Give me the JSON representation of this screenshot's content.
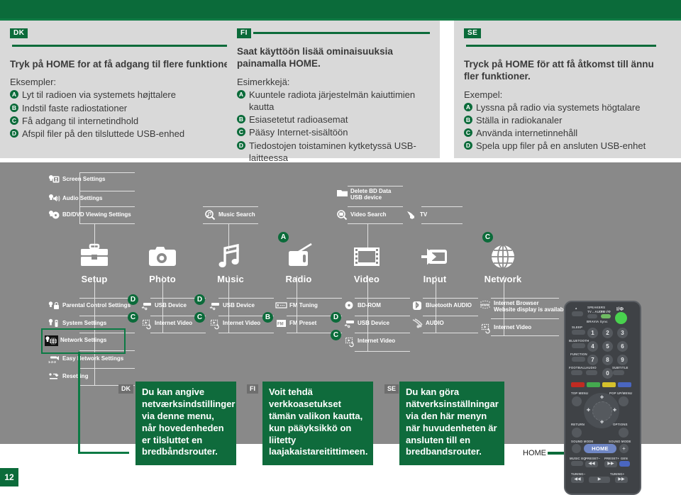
{
  "page": {
    "number": "12"
  },
  "panels": [
    {
      "tag": "DK",
      "headline": "Tryk på HOME for at få adgang til flere funktioner.",
      "sub": "Eksempler:",
      "items": [
        {
          "badge": "A",
          "text": "Lyt til radioen via systemets højttalere"
        },
        {
          "badge": "B",
          "text": "Indstil faste radiostationer"
        },
        {
          "badge": "C",
          "text": "Få adgang til internetindhold"
        },
        {
          "badge": "D",
          "text": "Afspil filer på den tilsluttede USB-enhed"
        }
      ]
    },
    {
      "tag": "FI",
      "headline": "Saat käyttöön lisää ominaisuuksia painamalla HOME.",
      "sub": "Esimerkkejä:",
      "items": [
        {
          "badge": "A",
          "text": "Kuuntele radiota järjestelmän kaiuttimien kautta"
        },
        {
          "badge": "B",
          "text": "Esiasetetut radioasemat"
        },
        {
          "badge": "C",
          "text": "Pääsy Internet-sisältöön"
        },
        {
          "badge": "D",
          "text": "Tiedostojen toistaminen kytketyssä USB-laitteessa"
        }
      ]
    },
    {
      "tag": "SE",
      "headline": "Tryck på HOME för att få åtkomst till ännu fler funktioner.",
      "sub": "Exempel:",
      "items": [
        {
          "badge": "A",
          "text": "Lyssna på radio via systemets högtalare"
        },
        {
          "badge": "B",
          "text": "Ställa in radiokanaler"
        },
        {
          "badge": "C",
          "text": "Använda internetinnehåll"
        },
        {
          "badge": "D",
          "text": "Spela upp filer på en ansluten USB-enhet"
        }
      ]
    }
  ],
  "menu_map": {
    "main_icons": [
      {
        "label": "Setup",
        "icon": "toolbox-icon",
        "badge": ""
      },
      {
        "label": "Photo",
        "icon": "camera-icon",
        "badge": ""
      },
      {
        "label": "Music",
        "icon": "music-note-icon",
        "badge": ""
      },
      {
        "label": "Radio",
        "icon": "radio-icon",
        "badge": "A"
      },
      {
        "label": "Video",
        "icon": "film-strip-icon",
        "badge": ""
      },
      {
        "label": "Input",
        "icon": "input-arrow-icon",
        "badge": ""
      },
      {
        "label": "Network",
        "icon": "globe-icon",
        "badge": "C"
      }
    ],
    "setup_upper": [
      {
        "label": "Screen Settings",
        "icon": "screen-settings-icon"
      },
      {
        "label": "Audio Settings",
        "icon": "audio-settings-icon"
      },
      {
        "label": "BD/DVD Viewing Settings",
        "icon": "bd-dvd-settings-icon"
      }
    ],
    "setup_lower": [
      {
        "label": "Parental Control Settings",
        "icon": "parental-lock-icon",
        "badge": ""
      },
      {
        "label": "System Settings",
        "icon": "system-settings-icon",
        "badge": ""
      },
      {
        "label": "Network Settings",
        "icon": "network-settings-icon",
        "badge": "",
        "highlighted": true
      },
      {
        "label": "Easy Network Settings",
        "icon": "easy-network-icon",
        "badge": ""
      },
      {
        "label": "Resetting",
        "icon": "resetting-icon",
        "badge": ""
      }
    ],
    "music_children": [
      {
        "label": "Music Search",
        "icon": "music-search-icon"
      }
    ],
    "photo_children": [
      {
        "label": "USB Device",
        "icon": "usb-device-icon",
        "badge": "D"
      },
      {
        "label": "Internet Video",
        "icon": "internet-video-icon",
        "badge": "C"
      }
    ],
    "music_sources": [
      {
        "label": "USB Device",
        "icon": "usb-device-icon",
        "badge": "D"
      },
      {
        "label": "Internet Video",
        "icon": "internet-video-icon",
        "badge": "C"
      }
    ],
    "radio_children": [
      {
        "label": "FM Tuning",
        "icon": "fm-tuning-icon",
        "badge": ""
      },
      {
        "label": "FM Preset",
        "icon": "fm-preset-icon",
        "badge": "B"
      }
    ],
    "video_top": [
      {
        "label": "Delete BD Data\nUSB device",
        "icon": "folder-icon"
      },
      {
        "label": "Video Search",
        "icon": "video-search-icon"
      },
      {
        "label": "TV",
        "icon": "tv-icon"
      }
    ],
    "video_children": [
      {
        "label": "BD-ROM",
        "icon": "disc-icon",
        "badge": ""
      },
      {
        "label": "USB Device",
        "icon": "usb-device-icon",
        "badge": "D"
      },
      {
        "label": "Internet Video",
        "icon": "internet-video-icon",
        "badge": "C"
      }
    ],
    "input_children": [
      {
        "label": "Bluetooth AUDIO",
        "icon": "bluetooth-icon"
      },
      {
        "label": "AUDIO",
        "icon": "audio-cable-icon"
      }
    ],
    "network_children": [
      {
        "label": "Internet Browser\nWebsite display is available",
        "icon": "www-icon"
      },
      {
        "label": "Internet Video",
        "icon": "internet-video-icon"
      }
    ]
  },
  "callouts": [
    {
      "tag": "DK",
      "text": "Du kan angive netværksindstillinger via denne menu, når hovedenheden er tilsluttet en bredbåndsrouter."
    },
    {
      "tag": "FI",
      "text": "Voit tehdä verkkoasetukset tämän valikon kautta, kun pääyksikkö on liitetty laajakaistareitittimeen."
    },
    {
      "tag": "SE",
      "text": "Du kan göra nätverksinställningar via den här menyn när huvudenheten är ansluten till en bredbandsrouter."
    }
  ],
  "remote": {
    "home_callout_label": "HOME",
    "home_button": "HOME",
    "labels": {
      "speakers": "SPEAKERS",
      "tv_audio": "TV↔AUDIO",
      "tv_power": "TV I/Φ",
      "bravia": "BRAVIA Sync",
      "power": "I/Φ",
      "sleep": "SLEEP",
      "bluetooth": "BLUETOOTH",
      "function": "FUNCTION",
      "football": "FOOTBALL",
      "audio": "AUDIO",
      "subtitle": "SUBTITLE",
      "top_menu": "TOP MENU",
      "popup_menu": "POP UP/MENU",
      "return": "RETURN",
      "options": "OPTIONS",
      "sound_mode_l": "SOUND MODE",
      "sound_mode_r": "SOUND MODE",
      "music_eq": "MUSIC EQ",
      "preset_minus": "PRESET−",
      "preset_plus": "PRESET+",
      "gen": "GEN",
      "tuning_minus": "TUNING−",
      "tuning_plus": "TUNING+"
    },
    "numbers": [
      "1",
      "2",
      "3",
      "4",
      "5",
      "6",
      "7",
      "8",
      "9",
      "0"
    ]
  },
  "colors": {
    "green": "#0b6b3a",
    "green_light": "#0f7a43",
    "panel_bg": "#d9d9d9",
    "map_bg": "#898989",
    "callout_bg": "#0f6b3c"
  }
}
